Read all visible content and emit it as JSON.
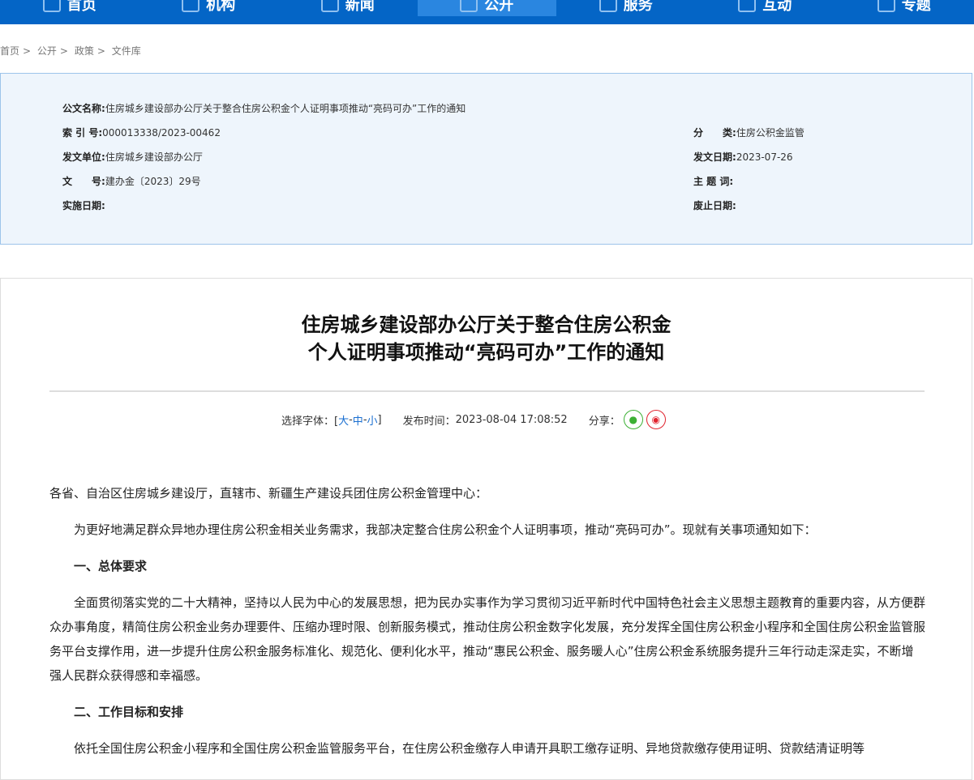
{
  "nav": [
    "首页",
    "机构",
    "新闻",
    "公开",
    "服务",
    "互动",
    "专题"
  ],
  "breadcrumb": [
    "首页",
    "公开",
    "政策",
    "文件库"
  ],
  "info": {
    "name_label": "公文名称:",
    "name": "住房城乡建设部办公厅关于整合住房公积金个人证明事项推动“亮码可办”工作的通知",
    "index_label": "索 引 号:",
    "index": "000013338/2023-00462",
    "category_label": "分　　类:",
    "category": "住房公积金监管",
    "issuer_label": "发文单位:",
    "issuer": "住房城乡建设部办公厅",
    "date_label": "发文日期:",
    "date": "2023-07-26",
    "docno_label": "文　　号:",
    "docno": "建办金〔2023〕29号",
    "subject_label": "主 题 词:",
    "subject": "",
    "effective_label": "实施日期:",
    "effective": "",
    "expire_label": "废止日期:",
    "expire": ""
  },
  "article": {
    "title1": "住房城乡建设部办公厅关于整合住房公积金",
    "title2": "个人证明事项推动“亮码可办”工作的通知",
    "font_label": "选择字体：[",
    "font_big": "大",
    "font_mid": "中",
    "font_small": "小",
    "sep": " - ",
    "font_end": "]",
    "time_label": "发布时间：",
    "time": "2023-08-04 17:08:52",
    "share_label": "分享：",
    "p0": "各省、自治区住房城乡建设厅，直辖市、新疆生产建设兵团住房公积金管理中心：",
    "p1": "为更好地满足群众异地办理住房公积金相关业务需求，我部决定整合住房公积金个人证明事项，推动“亮码可办”。现就有关事项通知如下：",
    "h1": "一、总体要求",
    "p2": "全面贯彻落实党的二十大精神，坚持以人民为中心的发展思想，把为民办实事作为学习贯彻习近平新时代中国特色社会主义思想主题教育的重要内容，从方便群众办事角度，精简住房公积金业务办理要件、压缩办理时限、创新服务模式，推动住房公积金数字化发展，充分发挥全国住房公积金小程序和全国住房公积金监管服务平台支撑作用，进一步提升住房公积金服务标准化、规范化、便利化水平，推动“惠民公积金、服务暖人心”住房公积金系统服务提升三年行动走深走实，不断增强人民群众获得感和幸福感。",
    "h2": "二、工作目标和安排",
    "p3": "依托全国住房公积金小程序和全国住房公积金监管服务平台，在住房公积金缴存人申请开具职工缴存证明、异地贷款缴存使用证明、贷款结清证明等"
  }
}
